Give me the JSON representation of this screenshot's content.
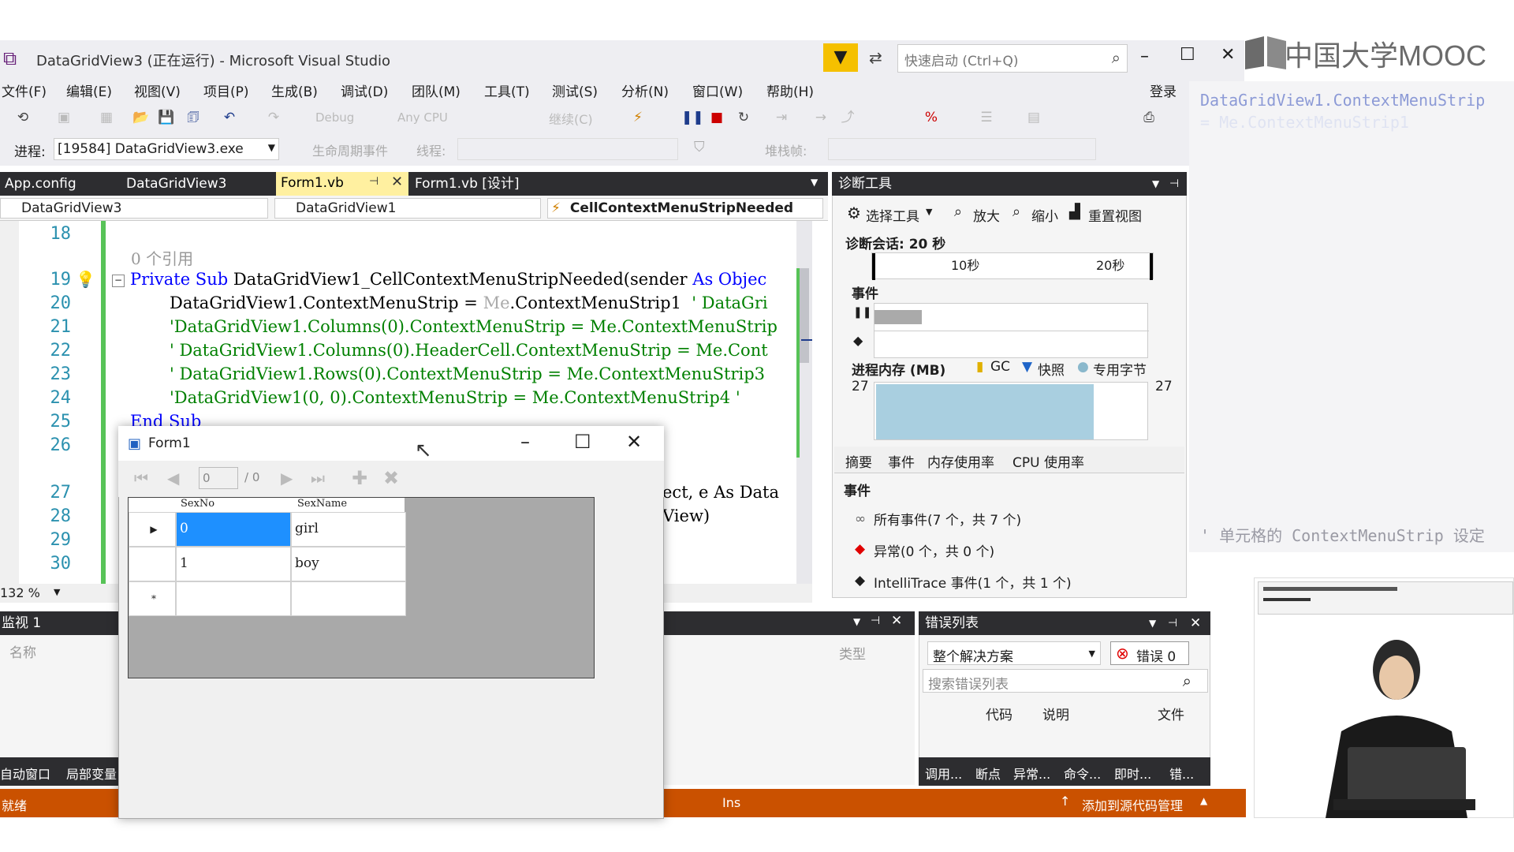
{
  "window": {
    "title": "DataGridView3 (正在运行) - Microsoft Visual Studio",
    "quick_launch_placeholder": "快速启动 (Ctrl+Q)",
    "login": "登录"
  },
  "menu": [
    "文件(F)",
    "编辑(E)",
    "视图(V)",
    "项目(P)",
    "生成(B)",
    "调试(D)",
    "团队(M)",
    "工具(T)",
    "测试(S)",
    "分析(N)",
    "窗口(W)",
    "帮助(H)"
  ],
  "toolbar": {
    "config": "Debug",
    "platform": "Any CPU",
    "continue": "继续(C)"
  },
  "process_bar": {
    "label": "进程:",
    "process": "[19584] DataGridView3.exe",
    "lifecycle": "生命周期事件",
    "thread": "线程:",
    "stackframe": "堆栈帧:"
  },
  "doc_tabs": [
    "App.config",
    "DataGridView3",
    "Form1.vb",
    "Form1.vb [设计]"
  ],
  "nav": {
    "project": "DataGridView3",
    "object": "DataGridView1",
    "method": "CellContextMenuStripNeeded"
  },
  "editor": {
    "zoom": "132 %",
    "ref_count": "0 个引用",
    "line_numbers": [
      "18",
      "19",
      "20",
      "21",
      "22",
      "23",
      "24",
      "25",
      "26",
      "27",
      "28",
      "29",
      "30"
    ],
    "lines": {
      "l19_kw1": "Private Sub ",
      "l19_rest": "DataGridView1_CellContextMenuStripNeeded(sender ",
      "l19_kw2": "As Objec",
      "l20": "DataGridView1.ContextMenuStrip = ",
      "l20_me": "Me",
      "l20_rest": ".ContextMenuStrip1  ",
      "l20_cm": "' DataGri",
      "l21": "'DataGridView1.Columns(0).ContextMenuStrip = Me.ContextMenuStrip",
      "l22": "' DataGridView1.Columns(0).HeaderCell.ContextMenuStrip = Me.Cont",
      "l23": "' DataGridView1.Rows(0).ContextMenuStrip = Me.ContextMenuStrip3",
      "l24": "'DataGridView1(0, 0).ContextMenuStrip = Me.ContextMenuStrip4 '",
      "l25": "End Sub",
      "l27_tail": "ect, e As Data",
      "l28_tail": "View)"
    }
  },
  "form1": {
    "title": "Form1",
    "position": "0",
    "count": "/ 0",
    "columns": [
      "SexNo",
      "SexName"
    ],
    "rows": [
      [
        "0",
        "girl"
      ],
      [
        "1",
        "boy"
      ]
    ]
  },
  "diagnostics": {
    "title": "诊断工具",
    "select_tool": "选择工具",
    "zoom_in": "放大",
    "zoom_out": "缩小",
    "reset_view": "重置视图",
    "session": "诊断会话: 20 秒",
    "tick_10": "10秒",
    "tick_20": "20秒",
    "events_label": "事件",
    "memory_label": "进程内存 (MB)",
    "legend_gc": "GC",
    "legend_snapshot": "快照",
    "legend_private": "专用字节",
    "mem_left": "27",
    "mem_right": "27",
    "tabs": [
      "摘要",
      "事件",
      "内存使用率",
      "CPU 使用率"
    ],
    "events_header": "事件",
    "all_events": "所有事件(7 个，共 7 个)",
    "exceptions": "异常(0 个，共 0 个)",
    "intellitrace": "IntelliTrace 事件(1 个，共 1 个)"
  },
  "watch": {
    "title": "监视 1",
    "name_col": "名称",
    "type_col": "类型",
    "tab_auto": "自动窗口",
    "tab_locals": "局部变量"
  },
  "errors": {
    "title": "错误列表",
    "scope": "整个解决方案",
    "errors_btn": "错误 0",
    "search_placeholder": "搜索错误列表",
    "col_code": "代码",
    "col_desc": "说明",
    "col_file": "文件",
    "bottom_tabs": [
      "调用...",
      "断点",
      "异常...",
      "命令...",
      "即时...",
      "错..."
    ]
  },
  "status": {
    "ready": "就绪",
    "ins": "Ins",
    "source_control": "添加到源代码管理"
  },
  "side_code": {
    "line1": "DataGridView1.ContextMenuStrip",
    "line2": "= Me.ContextMenuStrip1",
    "caption": "' 单元格的 ContextMenuStrip 设定"
  },
  "logo": {
    "text": "中国大学MOOC"
  }
}
